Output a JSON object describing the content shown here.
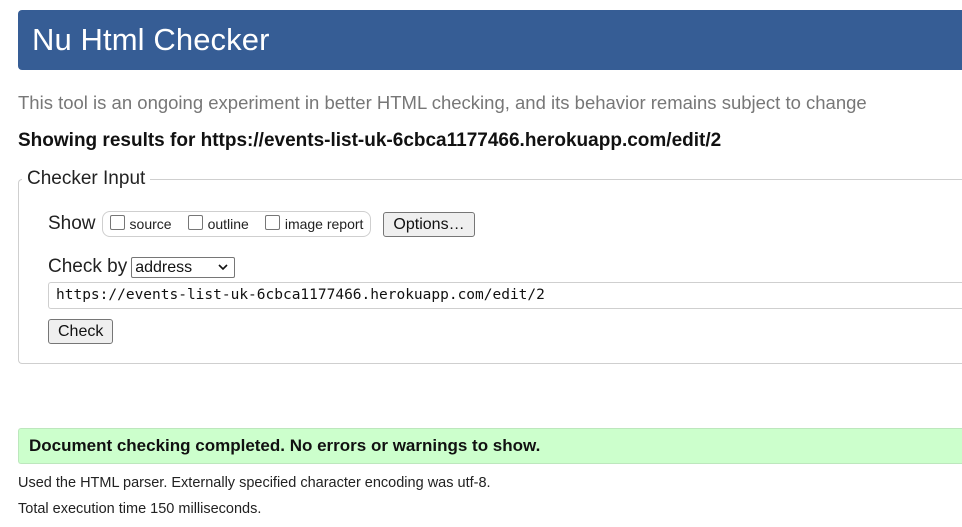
{
  "header": {
    "title": "Nu Html Checker"
  },
  "subtitle": "This tool is an ongoing experiment in better HTML checking, and its behavior remains subject to change",
  "results_for": "Showing results for https://events-list-uk-6cbca1177466.herokuapp.com/edit/2",
  "checker_input": {
    "legend": "Checker Input",
    "show_label": "Show",
    "show_options": [
      {
        "label": "source",
        "checked": false
      },
      {
        "label": "outline",
        "checked": false
      },
      {
        "label": "image report",
        "checked": false
      }
    ],
    "options_button": "Options…",
    "check_by_label": "Check by",
    "check_by_selected": "address",
    "url_value": "https://events-list-uk-6cbca1177466.herokuapp.com/edit/2",
    "check_button": "Check"
  },
  "result": {
    "message": "Document checking completed. No errors or warnings to show.",
    "status_color": "#ccffcc"
  },
  "info": {
    "parser": "Used the HTML parser. Externally specified character encoding was utf-8.",
    "execution_time": "Total execution time 150 milliseconds."
  },
  "colors": {
    "header_bg": "#365d95",
    "subtitle": "#777777"
  },
  "icons": {
    "select_arrow": "chevron-down-icon"
  }
}
